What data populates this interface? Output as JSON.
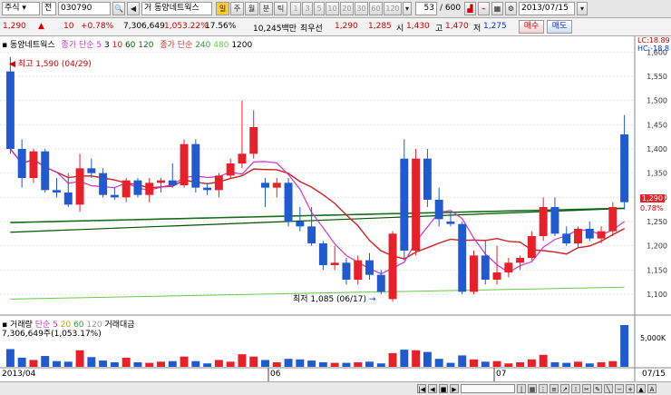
{
  "toolbar": {
    "market": "주식",
    "prev_label": "전",
    "code": "030790",
    "mode": "거",
    "name": "동양네트웍스",
    "tabs": [
      "일",
      "주",
      "월",
      "분",
      "틱"
    ],
    "minute_buttons": [
      "1",
      "3",
      "5",
      "10",
      "20",
      "30",
      "60",
      "120"
    ],
    "count_value": "53",
    "count_total": "/ 600",
    "date": "2013/07/15"
  },
  "quote": {
    "price": "1,290",
    "change": "10",
    "change_pct": "+0.78%",
    "volume": "7,306,649",
    "vol_ratio": "1,053.22%",
    "turnover": "17.56%",
    "amount": "10,245백만",
    "best_label": "최우선",
    "bid": "1,290",
    "ask": "1,285",
    "open_label": "시",
    "open": "1,430",
    "high_label": "고",
    "high": "1,470",
    "low_label": "저",
    "low": "1,275",
    "buy_label": "매수",
    "sell_label": "매도"
  },
  "legend": {
    "name": "동양네트웍스",
    "ma_prefix": "종가 단순",
    "ma_short": [
      "5",
      "3",
      "10",
      "60",
      "120"
    ],
    "ma_prefix2": "종가 단순",
    "ma_long": [
      "240",
      "480",
      "1200"
    ]
  },
  "annotations": {
    "high": "최고 1,590 (04/29)",
    "low": "최저 1,085 (06/17)"
  },
  "right_labels": {
    "lc": "LC:18.89",
    "hc": "HC:-18.8",
    "price": "1,290",
    "pct": "0.78%"
  },
  "volume_panel": {
    "title": "거래량",
    "ma_label": "단순",
    "ma_values": [
      "5",
      "20",
      "60",
      "120"
    ],
    "extra": "거래대금",
    "value": "7,306,649주(1,053.17%)",
    "axis_label": "5,000K"
  },
  "dates": {
    "start": "2013/04",
    "m06": "06",
    "m07": "07",
    "end": "07/15"
  },
  "colors": {
    "up": "#e8202a",
    "down": "#1f5ad0",
    "ma5": "#cc33cc",
    "ma10": "#d02020",
    "ma60": "#005500",
    "ma120": "#1a6e1a",
    "ma240": "#66cc44"
  },
  "chart_data": {
    "type": "candlestick",
    "ylim": [
      1070,
      1610
    ],
    "yticks": [
      1100,
      1150,
      1200,
      1250,
      1300,
      1350,
      1400,
      1450,
      1500,
      1550,
      1600
    ],
    "candles": [
      [
        1560,
        1590,
        1390,
        1400
      ],
      [
        1400,
        1420,
        1320,
        1340
      ],
      [
        1340,
        1400,
        1330,
        1395
      ],
      [
        1395,
        1400,
        1310,
        1315
      ],
      [
        1315,
        1340,
        1300,
        1310
      ],
      [
        1310,
        1350,
        1280,
        1285
      ],
      [
        1285,
        1390,
        1270,
        1360
      ],
      [
        1360,
        1380,
        1340,
        1350
      ],
      [
        1350,
        1360,
        1300,
        1305
      ],
      [
        1305,
        1320,
        1295,
        1300
      ],
      [
        1300,
        1340,
        1290,
        1335
      ],
      [
        1335,
        1340,
        1300,
        1305
      ],
      [
        1305,
        1340,
        1290,
        1330
      ],
      [
        1330,
        1340,
        1310,
        1335
      ],
      [
        1335,
        1370,
        1320,
        1325
      ],
      [
        1325,
        1420,
        1320,
        1410
      ],
      [
        1410,
        1420,
        1310,
        1320
      ],
      [
        1320,
        1330,
        1305,
        1315
      ],
      [
        1315,
        1350,
        1300,
        1345
      ],
      [
        1345,
        1380,
        1340,
        1370
      ],
      [
        1370,
        1500,
        1360,
        1390
      ],
      [
        1390,
        1480,
        1380,
        1445
      ],
      [
        1330,
        1340,
        1280,
        1320
      ],
      [
        1320,
        1340,
        1300,
        1330
      ],
      [
        1330,
        1340,
        1240,
        1250
      ],
      [
        1250,
        1280,
        1230,
        1240
      ],
      [
        1240,
        1280,
        1200,
        1205
      ],
      [
        1205,
        1210,
        1150,
        1160
      ],
      [
        1160,
        1200,
        1150,
        1165
      ],
      [
        1165,
        1175,
        1120,
        1130
      ],
      [
        1130,
        1180,
        1120,
        1170
      ],
      [
        1170,
        1185,
        1130,
        1140
      ],
      [
        1140,
        1150,
        1100,
        1105
      ],
      [
        1090,
        1230,
        1085,
        1225
      ],
      [
        1380,
        1420,
        1170,
        1190
      ],
      [
        1190,
        1400,
        1180,
        1380
      ],
      [
        1380,
        1400,
        1280,
        1295
      ],
      [
        1295,
        1320,
        1240,
        1255
      ],
      [
        1250,
        1270,
        1240,
        1245
      ],
      [
        1245,
        1250,
        1100,
        1105
      ],
      [
        1105,
        1190,
        1100,
        1180
      ],
      [
        1180,
        1210,
        1120,
        1130
      ],
      [
        1130,
        1200,
        1120,
        1145
      ],
      [
        1145,
        1175,
        1135,
        1165
      ],
      [
        1165,
        1180,
        1150,
        1175
      ],
      [
        1175,
        1230,
        1170,
        1220
      ],
      [
        1220,
        1300,
        1210,
        1280
      ],
      [
        1280,
        1300,
        1220,
        1225
      ],
      [
        1225,
        1240,
        1200,
        1205
      ],
      [
        1205,
        1240,
        1195,
        1235
      ],
      [
        1235,
        1250,
        1210,
        1215
      ],
      [
        1215,
        1240,
        1205,
        1230
      ],
      [
        1230,
        1290,
        1220,
        1280
      ],
      [
        1430,
        1470,
        1275,
        1290
      ]
    ],
    "volumes": [
      3.1,
      1.6,
      1.2,
      1.9,
      1.0,
      0.9,
      2.9,
      1.7,
      1.1,
      0.8,
      1.6,
      0.8,
      0.7,
      0.9,
      1.0,
      1.8,
      1.0,
      0.6,
      1.2,
      0.9,
      2.2,
      1.8,
      1.2,
      0.8,
      1.4,
      1.3,
      1.1,
      0.8,
      0.7,
      0.7,
      0.8,
      0.9,
      0.6,
      2.4,
      3.0,
      2.9,
      2.6,
      1.4,
      0.7,
      2.0,
      1.3,
      0.9,
      1.0,
      0.6,
      0.8,
      1.3,
      2.1,
      0.8,
      0.7,
      0.9,
      0.6,
      0.8,
      1.0,
      7.3
    ]
  }
}
